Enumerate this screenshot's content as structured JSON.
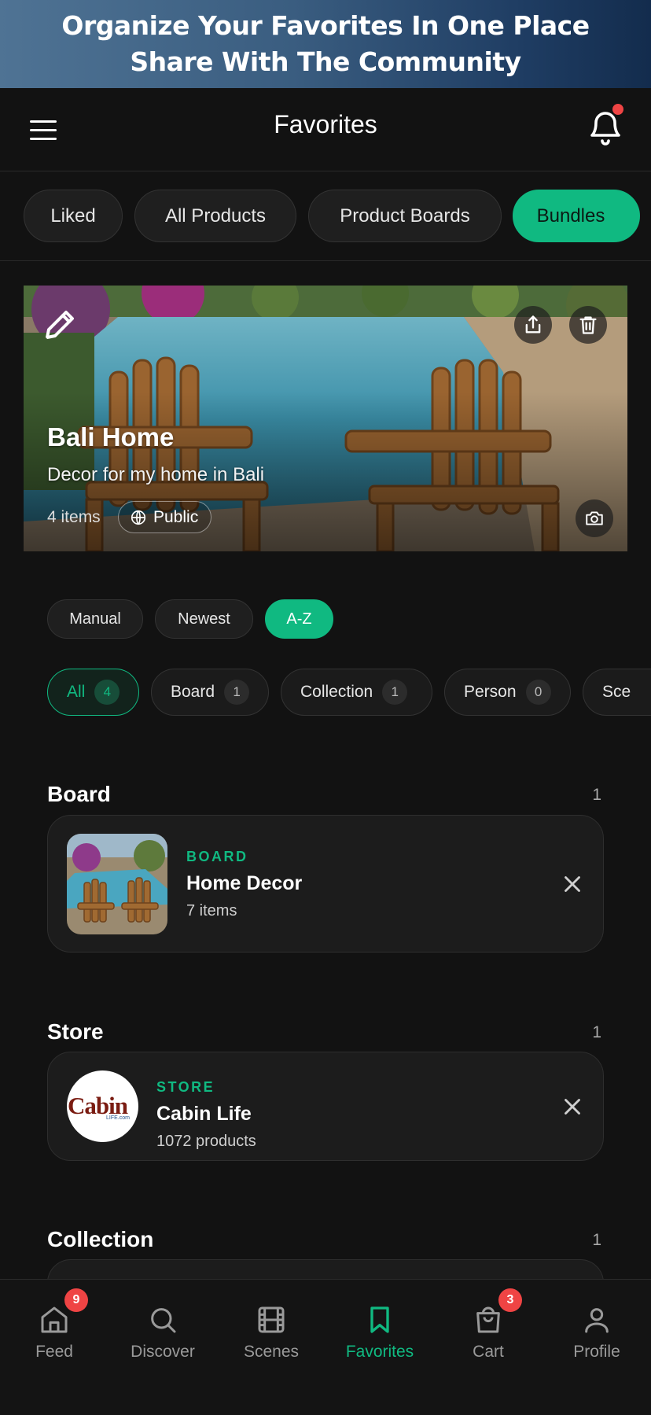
{
  "promo": {
    "line1": "Organize Your Favorites In One Place",
    "line2": "Share With The Community"
  },
  "header": {
    "title": "Favorites",
    "has_notification": true
  },
  "tabs": [
    {
      "label": "Liked",
      "active": false
    },
    {
      "label": "All Products",
      "active": false
    },
    {
      "label": "Product Boards",
      "active": false
    },
    {
      "label": "Bundles",
      "active": true
    }
  ],
  "hero": {
    "name": "Bali Home",
    "description": "Decor for my home in Bali",
    "count": "4 items",
    "visibility": "Public"
  },
  "sort": [
    {
      "label": "Manual",
      "active": false
    },
    {
      "label": "Newest",
      "active": false
    },
    {
      "label": "A-Z",
      "active": true
    }
  ],
  "filters": [
    {
      "label": "All",
      "count": "4",
      "active": true
    },
    {
      "label": "Board",
      "count": "1",
      "active": false
    },
    {
      "label": "Collection",
      "count": "1",
      "active": false
    },
    {
      "label": "Person",
      "count": "0",
      "active": false
    },
    {
      "label": "Sce",
      "count": "",
      "active": false
    }
  ],
  "sections": {
    "board": {
      "title": "Board",
      "count": "1",
      "item": {
        "kind": "BOARD",
        "name": "Home Decor",
        "sub": "7 items"
      }
    },
    "store": {
      "title": "Store",
      "count": "1",
      "item": {
        "kind": "STORE",
        "name": "Cabin Life",
        "sub": "1072 products",
        "logo_text": "Cabin",
        "logo_tag": "LIFE.com"
      }
    },
    "collection": {
      "title": "Collection",
      "count": "1"
    }
  },
  "nav": [
    {
      "label": "Feed",
      "icon": "home-icon",
      "badge": "9",
      "active": false
    },
    {
      "label": "Discover",
      "icon": "search-icon",
      "badge": "",
      "active": false
    },
    {
      "label": "Scenes",
      "icon": "film-icon",
      "badge": "",
      "active": false
    },
    {
      "label": "Favorites",
      "icon": "bookmark-icon",
      "badge": "",
      "active": true
    },
    {
      "label": "Cart",
      "icon": "bag-icon",
      "badge": "3",
      "active": false
    },
    {
      "label": "Profile",
      "icon": "user-icon",
      "badge": "",
      "active": false
    }
  ],
  "colors": {
    "accent": "#10b981",
    "background": "#121212",
    "badge": "#ef4444"
  }
}
